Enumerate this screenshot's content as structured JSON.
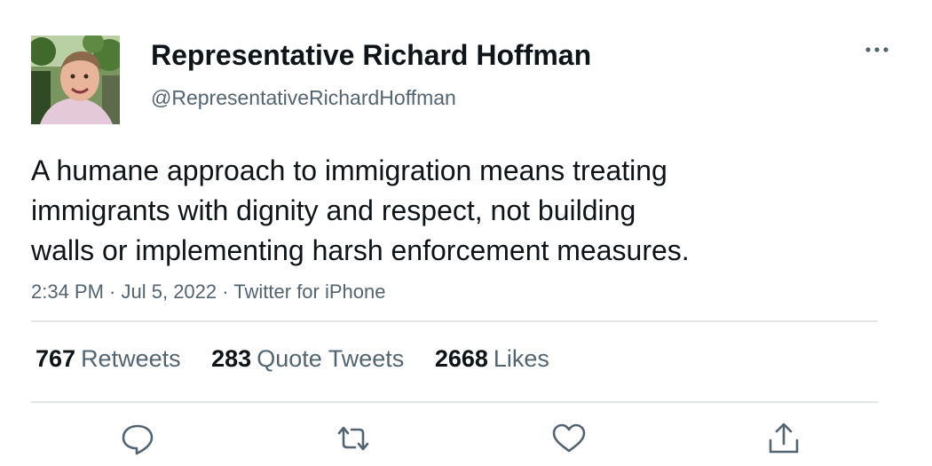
{
  "author": {
    "display_name": "Representative Richard Hoffman",
    "handle": "@RepresentativeRichardHoffman",
    "avatar_icon": "profile-photo"
  },
  "tweet": {
    "text_lines": [
      "A humane approach to immigration means treating",
      "immigrants with dignity and respect, not building",
      "walls or implementing harsh enforcement measures."
    ],
    "time": "2:34 PM",
    "date": "Jul 5, 2022",
    "source": "Twitter for iPhone",
    "separator": " · "
  },
  "stats": [
    {
      "count": "767",
      "label": "Retweets"
    },
    {
      "count": "283",
      "label": "Quote Tweets"
    },
    {
      "count": "2668",
      "label": "Likes"
    }
  ],
  "actions": [
    {
      "icon": "reply-icon"
    },
    {
      "icon": "retweet-icon"
    },
    {
      "icon": "like-icon"
    },
    {
      "icon": "share-icon"
    }
  ],
  "colors": {
    "primary_text": "#0f1419",
    "secondary_text": "#536471",
    "divider": "#e3e6e8",
    "background": "#ffffff"
  }
}
